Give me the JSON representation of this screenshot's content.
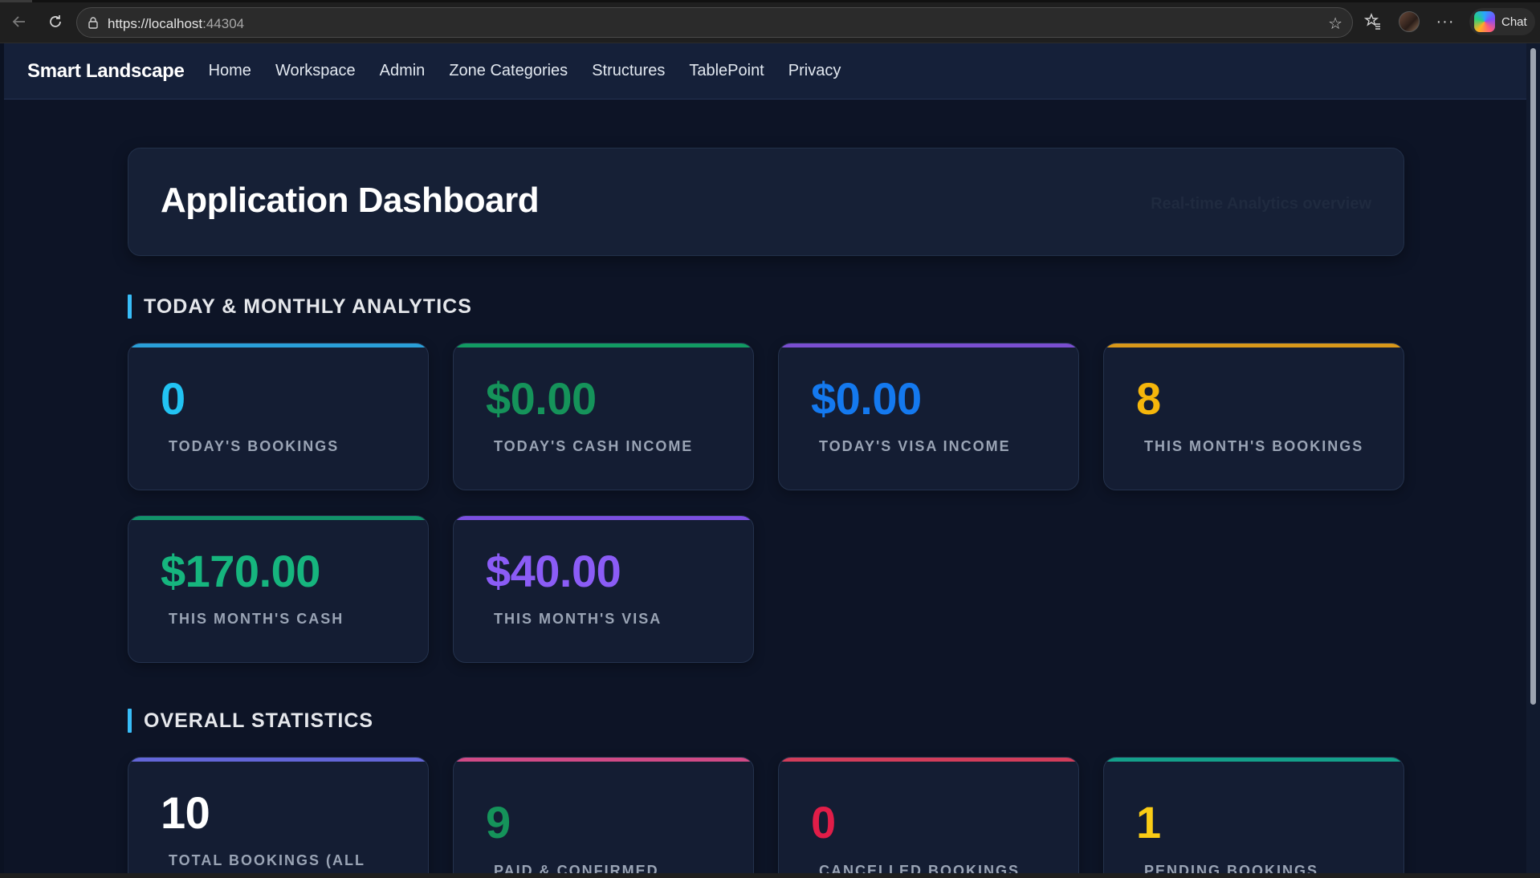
{
  "browser": {
    "url_main": "https://localhost",
    "url_port": ":44304",
    "chat_label": "Chat"
  },
  "nav": {
    "brand": "Smart Landscape",
    "links": [
      "Home",
      "Workspace",
      "Admin",
      "Zone Categories",
      "Structures",
      "TablePoint",
      "Privacy"
    ]
  },
  "hero": {
    "title": "Application Dashboard",
    "subtitle": "Real-time Analytics overview"
  },
  "sections": {
    "analytics_title": "TODAY & MONTHLY ANALYTICS",
    "overall_title": "OVERALL STATISTICS"
  },
  "analytics_cards": [
    {
      "value": "0",
      "label": "TODAY'S BOOKINGS",
      "value_color": "#22c3f3",
      "accent": "#2a9fd8"
    },
    {
      "value": "$0.00",
      "label": "TODAY'S CASH INCOME",
      "value_color": "#15935a",
      "accent": "#129a62"
    },
    {
      "value": "$0.00",
      "label": "TODAY'S VISA INCOME",
      "value_color": "#1479ef",
      "accent": "#7a4ed0"
    },
    {
      "value": "8",
      "label": "THIS MONTH'S BOOKINGS",
      "value_color": "#f5b60b",
      "accent": "#d9981a"
    },
    {
      "value": "$170.00",
      "label": "THIS MONTH'S CASH",
      "value_color": "#16b57e",
      "accent": "#12936a"
    },
    {
      "value": "$40.00",
      "label": "THIS MONTH'S VISA",
      "value_color": "#8b5cf6",
      "accent": "#7b4fe0"
    }
  ],
  "overall_cards": [
    {
      "value": "10",
      "label": "TOTAL BOOKINGS (ALL",
      "value_color": "#ffffff",
      "accent": "#6366d8"
    },
    {
      "value": "9",
      "label": "PAID & CONFIRMED",
      "value_color": "#15935a",
      "accent": "#d04a86"
    },
    {
      "value": "0",
      "label": "CANCELLED BOOKINGS",
      "value_color": "#e11d48",
      "accent": "#d23d5a"
    },
    {
      "value": "1",
      "label": "PENDING BOOKINGS",
      "value_color": "#facc15",
      "accent": "#14a08a"
    }
  ]
}
